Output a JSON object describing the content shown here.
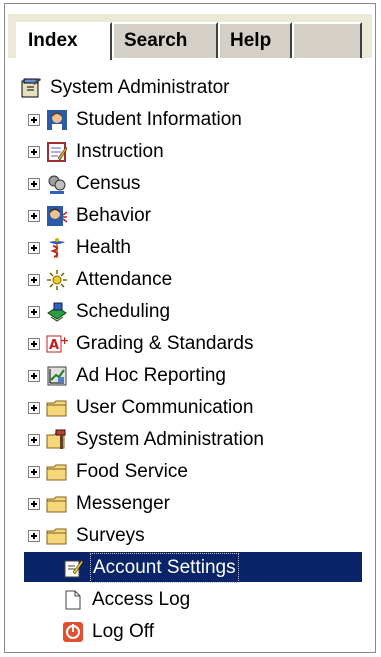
{
  "tabs": [
    {
      "label": "Index",
      "active": true
    },
    {
      "label": "Search",
      "active": false
    },
    {
      "label": "Help",
      "active": false
    }
  ],
  "tree": {
    "root": {
      "label": "System Administrator",
      "icon": "notebook-icon"
    },
    "items": [
      {
        "label": "Student Information",
        "icon": "student-icon"
      },
      {
        "label": "Instruction",
        "icon": "notepad-icon"
      },
      {
        "label": "Census",
        "icon": "census-icon"
      },
      {
        "label": "Behavior",
        "icon": "behavior-icon"
      },
      {
        "label": "Health",
        "icon": "caduceus-icon"
      },
      {
        "label": "Attendance",
        "icon": "sun-icon"
      },
      {
        "label": "Scheduling",
        "icon": "scheduling-icon"
      },
      {
        "label": "Grading & Standards",
        "icon": "grade-a-plus-icon"
      },
      {
        "label": "Ad Hoc Reporting",
        "icon": "report-chart-icon"
      },
      {
        "label": "User Communication",
        "icon": "folder-icon"
      },
      {
        "label": "System Administration",
        "icon": "tools-icon"
      },
      {
        "label": "Food Service",
        "icon": "folder-icon"
      },
      {
        "label": "Messenger",
        "icon": "folder-icon"
      },
      {
        "label": "Surveys",
        "icon": "folder-icon"
      }
    ],
    "leaves": [
      {
        "label": "Account Settings",
        "icon": "edit-document-icon",
        "selected": true
      },
      {
        "label": "Access Log",
        "icon": "document-icon",
        "selected": false
      },
      {
        "label": "Log Off",
        "icon": "power-icon",
        "selected": false
      }
    ]
  },
  "colors": {
    "selection": "#0a246a",
    "tab_bar": "#ece9d8",
    "folder": "#f5d77a"
  }
}
